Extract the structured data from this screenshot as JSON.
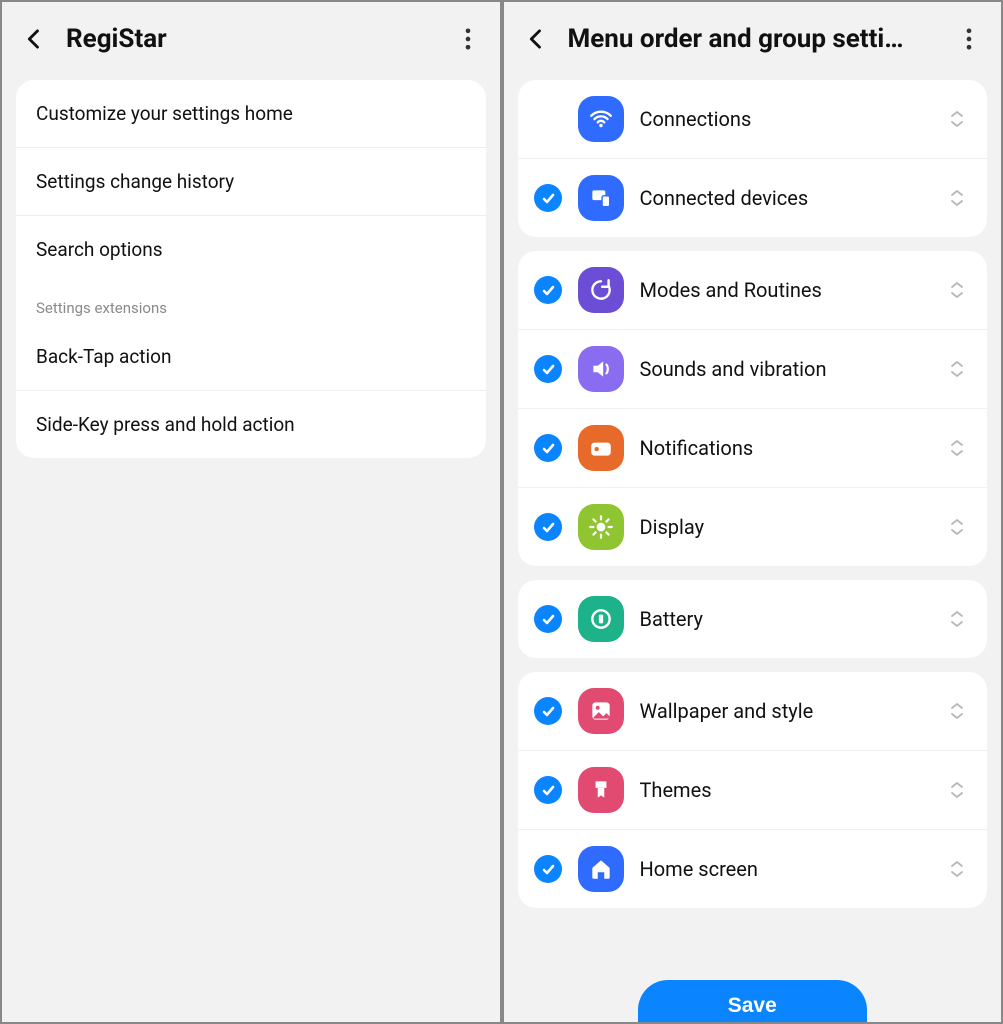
{
  "left": {
    "title": "RegiStar",
    "group1": [
      {
        "label": "Customize your settings home"
      },
      {
        "label": "Settings change history"
      },
      {
        "label": "Search options"
      }
    ],
    "section_label": "Settings extensions",
    "group2": [
      {
        "label": "Back-Tap action"
      },
      {
        "label": "Side-Key press and hold action"
      }
    ]
  },
  "right": {
    "title": "Menu order and group setti…",
    "save_label": "Save",
    "groups": [
      [
        {
          "label": "Connections",
          "icon": "wifi-icon",
          "color": "#2f6bff",
          "checked": false
        },
        {
          "label": "Connected devices",
          "icon": "devices-icon",
          "color": "#2f6bff",
          "checked": true
        }
      ],
      [
        {
          "label": "Modes and Routines",
          "icon": "refresh-icon",
          "color": "#6b4dd6",
          "checked": true
        },
        {
          "label": "Sounds and vibration",
          "icon": "sound-icon",
          "color": "#8a6cf0",
          "checked": true
        },
        {
          "label": "Notifications",
          "icon": "notifications-icon",
          "color": "#e86a2a",
          "checked": true
        },
        {
          "label": "Display",
          "icon": "brightness-icon",
          "color": "#8fc531",
          "checked": true
        }
      ],
      [
        {
          "label": "Battery",
          "icon": "battery-icon",
          "color": "#1db28a",
          "checked": true
        }
      ],
      [
        {
          "label": "Wallpaper and style",
          "icon": "wallpaper-icon",
          "color": "#e14a71",
          "checked": true
        },
        {
          "label": "Themes",
          "icon": "themes-icon",
          "color": "#e14a71",
          "checked": true
        },
        {
          "label": "Home screen",
          "icon": "home-icon",
          "color": "#2f6bff",
          "checked": true
        }
      ]
    ]
  }
}
